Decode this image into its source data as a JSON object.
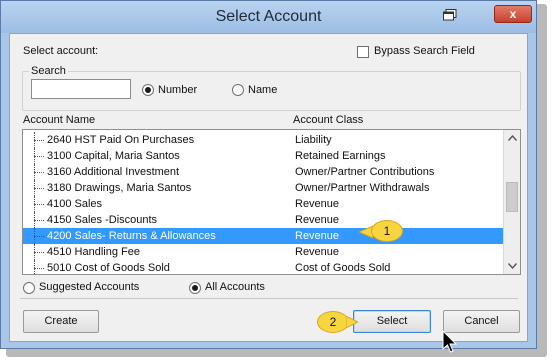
{
  "window": {
    "title": "Select Account",
    "close_glyph": "x"
  },
  "form": {
    "select_label": "Select account:",
    "bypass_label": "Bypass Search Field",
    "bypass_checked": false,
    "search_group_label": "Search",
    "search_value": "",
    "search_mode_number": "Number",
    "search_mode_name": "Name",
    "search_mode_selected": "Number"
  },
  "list": {
    "columns": {
      "name": "Account Name",
      "class": "Account Class"
    },
    "rows": [
      {
        "name": "2640 HST Paid On Purchases",
        "class": "Liability"
      },
      {
        "name": "3100 Capital, Maria Santos",
        "class": "Retained Earnings"
      },
      {
        "name": "3160 Additional Investment",
        "class": "Owner/Partner Contributions"
      },
      {
        "name": "3180 Drawings, Maria Santos",
        "class": "Owner/Partner Withdrawals"
      },
      {
        "name": "4100 Sales",
        "class": "Revenue"
      },
      {
        "name": "4150 Sales -Discounts",
        "class": "Revenue"
      },
      {
        "name": "4200 Sales- Returns & Allowances",
        "class": "Revenue",
        "selected": true
      },
      {
        "name": "4510 Handling Fee",
        "class": "Revenue"
      },
      {
        "name": "5010 Cost of Goods Sold",
        "class": "Cost of Goods Sold"
      }
    ]
  },
  "filter": {
    "suggested_label": "Suggested Accounts",
    "all_label": "All Accounts",
    "selected": "All Accounts"
  },
  "buttons": {
    "create": "Create",
    "select": "Select",
    "cancel": "Cancel"
  },
  "callouts": {
    "first": "1",
    "second": "2"
  },
  "colors": {
    "selection": "#3399ff",
    "callout": "#f7d53f",
    "titlebar": "#a9c6e8"
  }
}
